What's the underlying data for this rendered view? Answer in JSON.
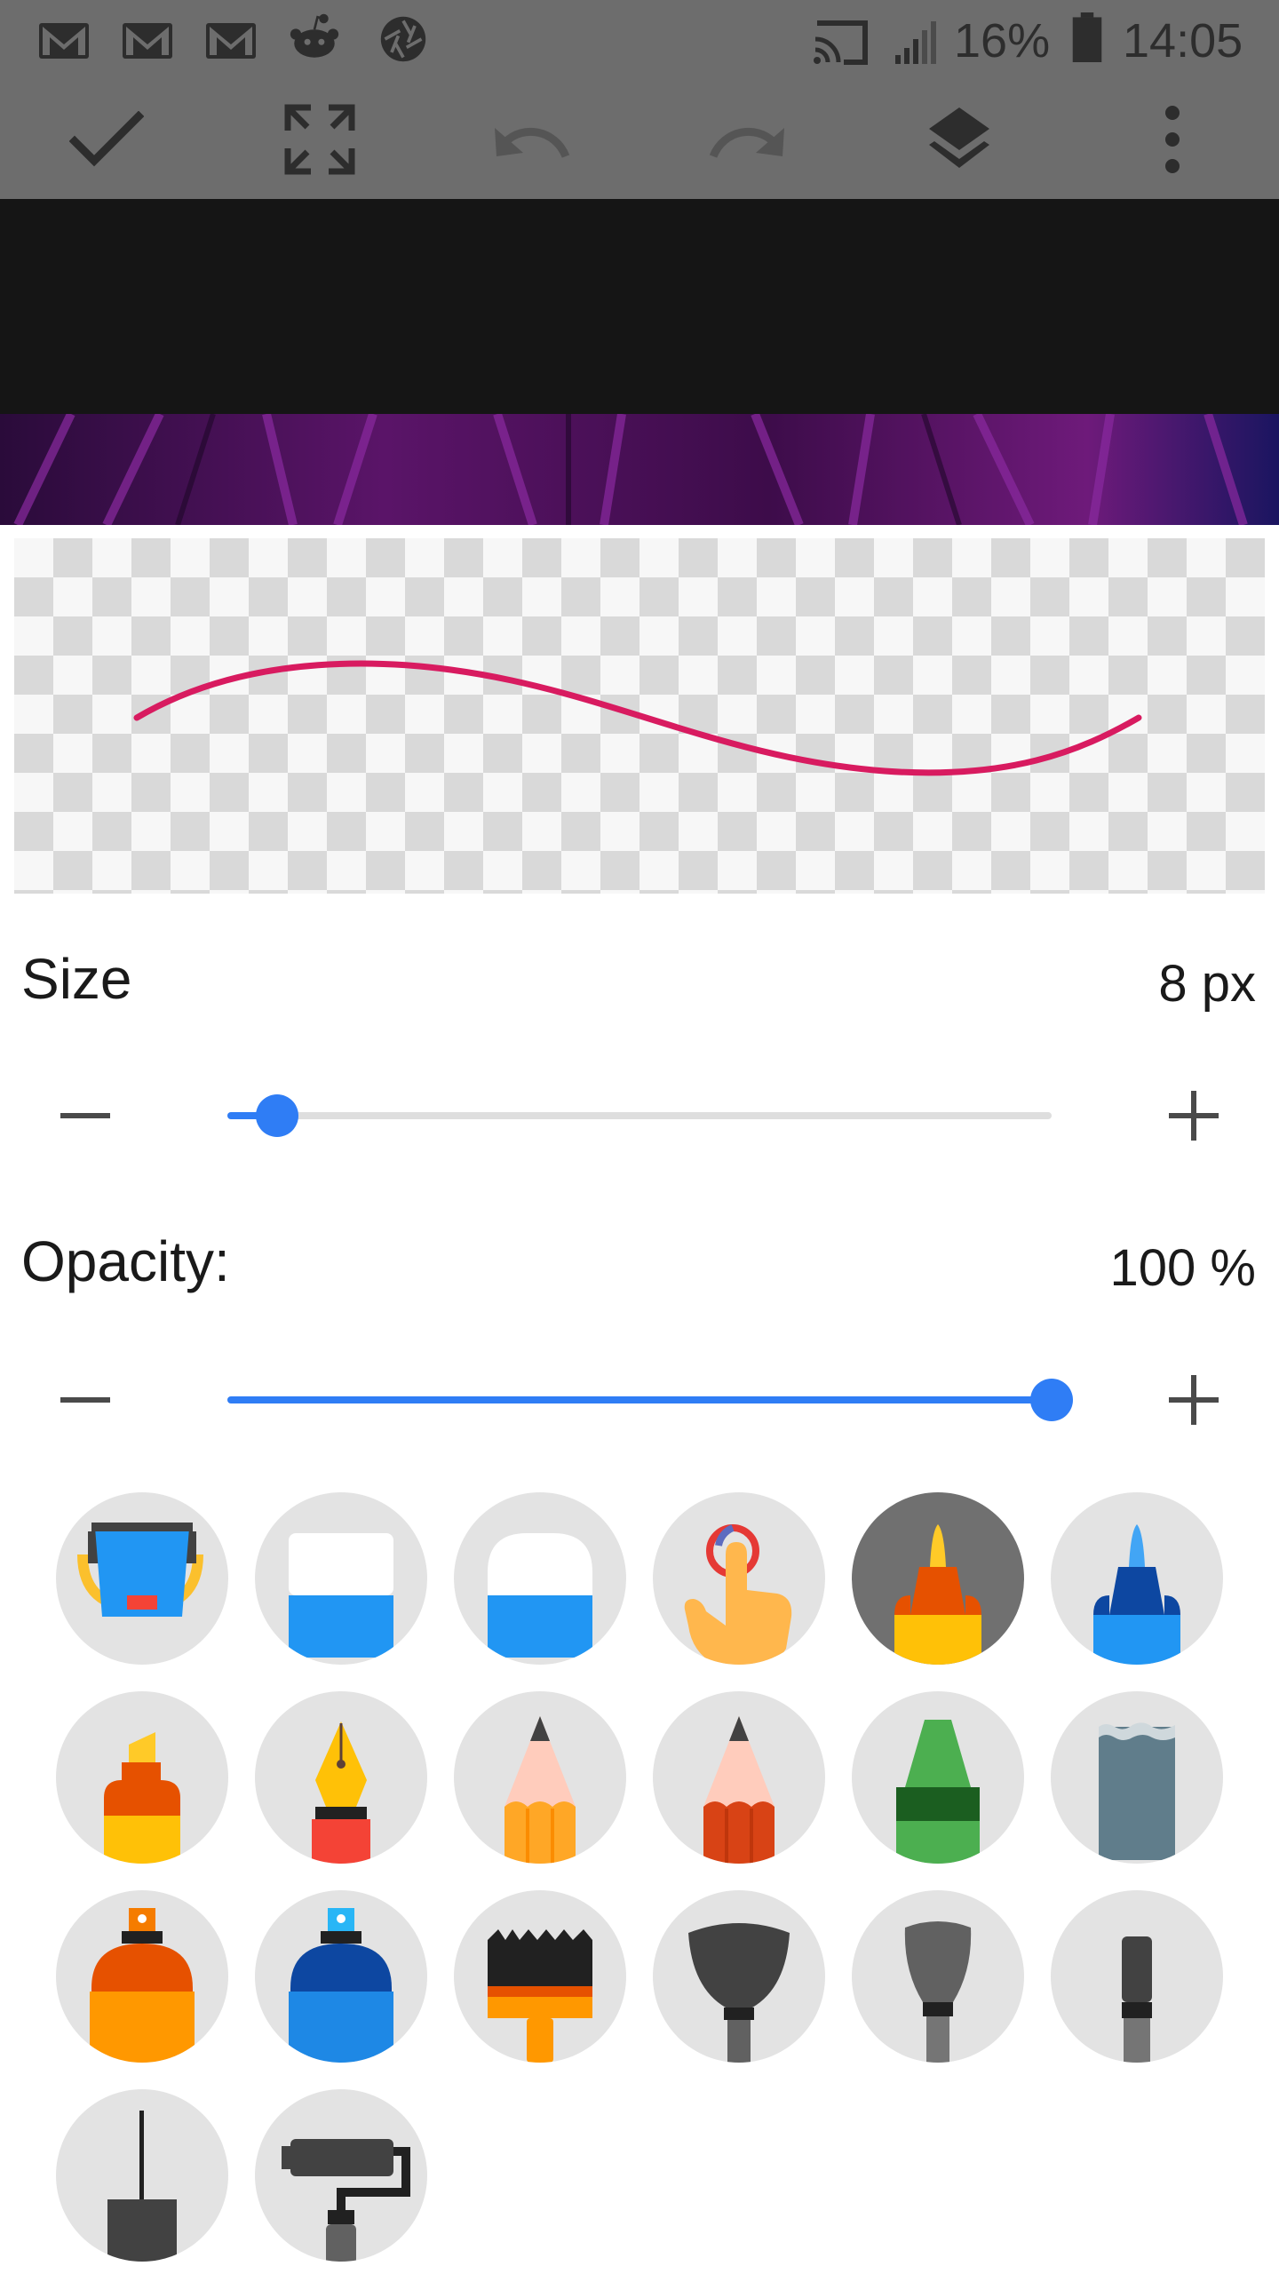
{
  "status_bar": {
    "battery": "16%",
    "time": "14:05",
    "icons": [
      "gmail-icon",
      "gmail-icon",
      "gmail-icon",
      "reddit-icon",
      "aperture-icon",
      "cast-icon",
      "signal-icon",
      "battery-icon"
    ]
  },
  "toolbar": {
    "buttons": [
      "check-icon",
      "fullscreen-icon",
      "undo-icon",
      "redo-icon",
      "layers-icon",
      "more-vert-icon"
    ]
  },
  "preview": {
    "stroke_color": "#d81b60"
  },
  "size": {
    "label": "Size",
    "value_text": "8 px",
    "fraction": 0.06
  },
  "opacity": {
    "label": "Opacity:",
    "value_text": "100 %",
    "fraction": 1.0
  },
  "accent_color": "#2f7df5",
  "tools": [
    "fill-bucket-tool",
    "eraser-square-tool",
    "eraser-round-tool",
    "smudge-finger-tool",
    "marker-orange-tool",
    "marker-blue-tool",
    "highlighter-tool",
    "fountain-pen-tool",
    "pencil-light-tool",
    "pencil-red-tool",
    "crayon-green-tool",
    "watercolor-tool",
    "spray-orange-tool",
    "spray-blue-tool",
    "flat-brush-tool",
    "fan-brush-tool",
    "round-brush-tool",
    "thin-brush-tool",
    "needle-brush-tool",
    "paint-roller-tool"
  ],
  "selected_tool": "marker-orange-tool"
}
